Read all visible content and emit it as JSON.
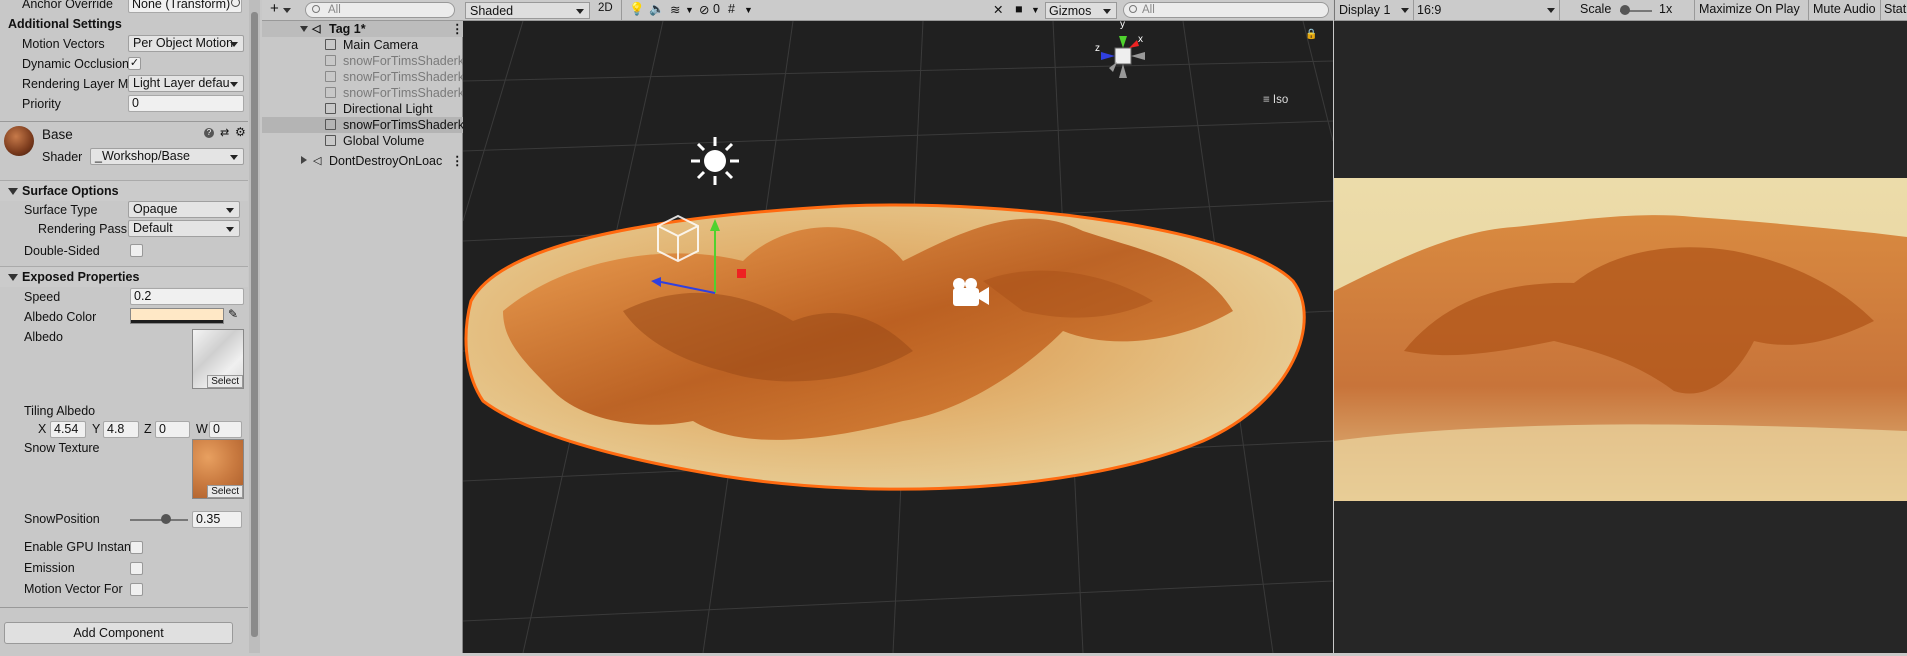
{
  "inspector": {
    "anchor_override_label": "Anchor Override",
    "anchor_override_value": "None (Transform)",
    "additional_settings": "Additional Settings",
    "motion_vectors_label": "Motion Vectors",
    "motion_vectors_value": "Per Object Motion",
    "dynamic_occlusion_label": "Dynamic Occlusion",
    "dynamic_occlusion_check": "✓",
    "rendering_layer_label": "Rendering Layer M",
    "rendering_layer_value": "Light Layer defau",
    "priority_label": "Priority",
    "priority_value": "0",
    "material_name": "Base",
    "shader_label": "Shader",
    "shader_value": "_Workshop/Base",
    "surface_options": "Surface Options",
    "surface_type_label": "Surface Type",
    "surface_type_value": "Opaque",
    "rendering_pass_label": "Rendering Pass",
    "rendering_pass_value": "Default",
    "double_sided_label": "Double-Sided",
    "exposed_properties": "Exposed Properties",
    "speed_label": "Speed",
    "speed_value": "0.2",
    "albedo_color_label": "Albedo Color",
    "albedo_label": "Albedo",
    "select": "Select",
    "tiling_albedo_label": "Tiling Albedo",
    "tiling": {
      "x_label": "X",
      "x": "4.54",
      "y_label": "Y",
      "y": "4.8",
      "z_label": "Z",
      "z": "0",
      "w_label": "W",
      "w": "0"
    },
    "snow_texture_label": "Snow Texture",
    "snow_position_label": "SnowPosition",
    "snow_position_value": "0.35",
    "snow_position_fraction": 0.35,
    "enable_gpu_label": "Enable GPU Instan",
    "emission_label": "Emission",
    "motion_vector_for_label": "Motion Vector For",
    "add_component": "Add Component",
    "colors": {
      "albedo": "#ffe8c6",
      "bar": "#1e1e1e"
    }
  },
  "hierarchy": {
    "add_label": "+",
    "search_placeholder": "All",
    "scene_name": "Tag 1*",
    "items": [
      {
        "label": "Main Camera",
        "dim": false
      },
      {
        "label": "snowForTimsShaderk",
        "dim": true
      },
      {
        "label": "snowForTimsShaderk",
        "dim": true
      },
      {
        "label": "snowForTimsShaderk",
        "dim": true
      },
      {
        "label": "Directional Light",
        "dim": false
      },
      {
        "label": "snowForTimsShaderk",
        "dim": false
      },
      {
        "label": "Global Volume",
        "dim": false
      }
    ],
    "dont_destroy": "DontDestroyOnLoac"
  },
  "scene_toolbar": {
    "shading": "Shaded",
    "mode_2d": "2D",
    "hidden_count": "0",
    "gizmos": "Gizmos",
    "search_placeholder": "All",
    "iso_label": "Iso",
    "axis_y": "y",
    "axis_x": "x",
    "axis_z": "z"
  },
  "game_toolbar": {
    "display": "Display 1",
    "aspect": "16:9",
    "scale_label": "Scale",
    "scale_value": "1x",
    "maximize": "Maximize On Play",
    "mute": "Mute Audio",
    "stats": "Stat"
  }
}
